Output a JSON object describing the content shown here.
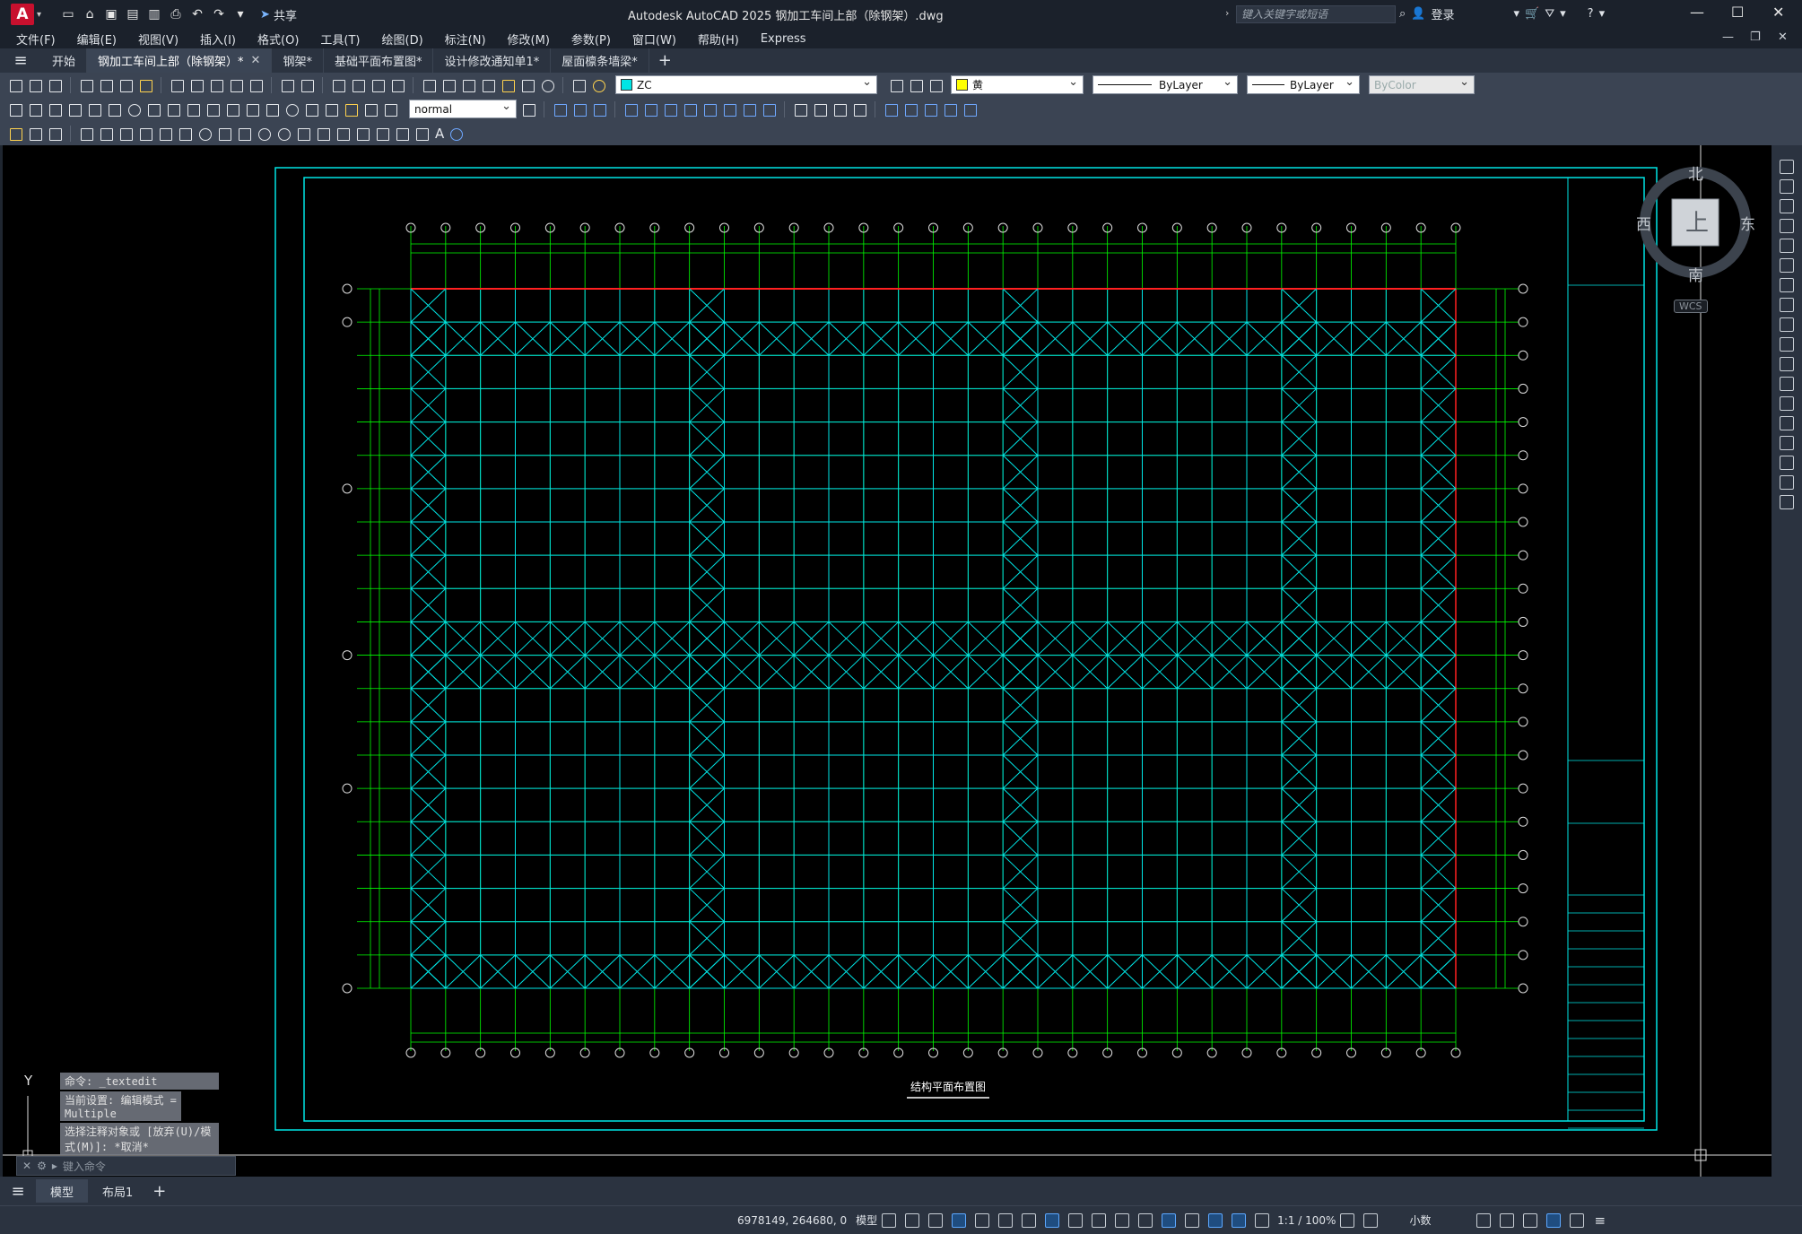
{
  "app": {
    "logo": "A",
    "title": "Autodesk AutoCAD 2025    钢加工车间上部（除钢架）.dwg",
    "share_label": "共享",
    "search_placeholder": "键入关键字或短语",
    "login_label": "登录"
  },
  "menu": {
    "items": [
      "文件(F)",
      "编辑(E)",
      "视图(V)",
      "插入(I)",
      "格式(O)",
      "工具(T)",
      "绘图(D)",
      "标注(N)",
      "修改(M)",
      "参数(P)",
      "窗口(W)",
      "帮助(H)",
      "Express"
    ]
  },
  "tabs": [
    {
      "label": "开始",
      "active": false,
      "closable": false
    },
    {
      "label": "钢加工车间上部（除钢架）*",
      "active": true,
      "closable": true
    },
    {
      "label": "钢架*",
      "active": false,
      "closable": false
    },
    {
      "label": "基础平面布置图*",
      "active": false,
      "closable": false
    },
    {
      "label": "设计修改通知单1*",
      "active": false,
      "closable": false
    },
    {
      "label": "屋面檩条墙梁*",
      "active": false,
      "closable": false
    }
  ],
  "toolbar": {
    "layer_name": "ZC",
    "color_name": "黄",
    "linetype": "ByLayer",
    "lineweight": "ByLayer",
    "plotstyle": "ByColor",
    "textstyle": "normal"
  },
  "colors": {
    "layer_swatch": "#00e5e5",
    "color_swatch": "#ffff00",
    "drawing_cyan": "#00e6e6",
    "drawing_green": "#00ff00",
    "drawing_red": "#ff2020"
  },
  "viewcube": {
    "north": "北",
    "south": "南",
    "east": "东",
    "west": "西",
    "face": "上",
    "wcs": "WCS"
  },
  "drawing": {
    "plan_title": "结构平面布置图"
  },
  "command": {
    "history": [
      "命令: _textedit",
      "当前设置: 编辑模式 = Multiple",
      "选择注释对象或 [放弃(U)/模式(M)]: *取消*"
    ],
    "placeholder": "键入命令"
  },
  "layouts": {
    "model": "模型",
    "layout1": "布局1"
  },
  "status": {
    "coords": "6978149, 264680, 0",
    "space": "模型",
    "scale": "1:1 / 100%",
    "units": "小数"
  },
  "ucs": {
    "y_label": "Y"
  }
}
